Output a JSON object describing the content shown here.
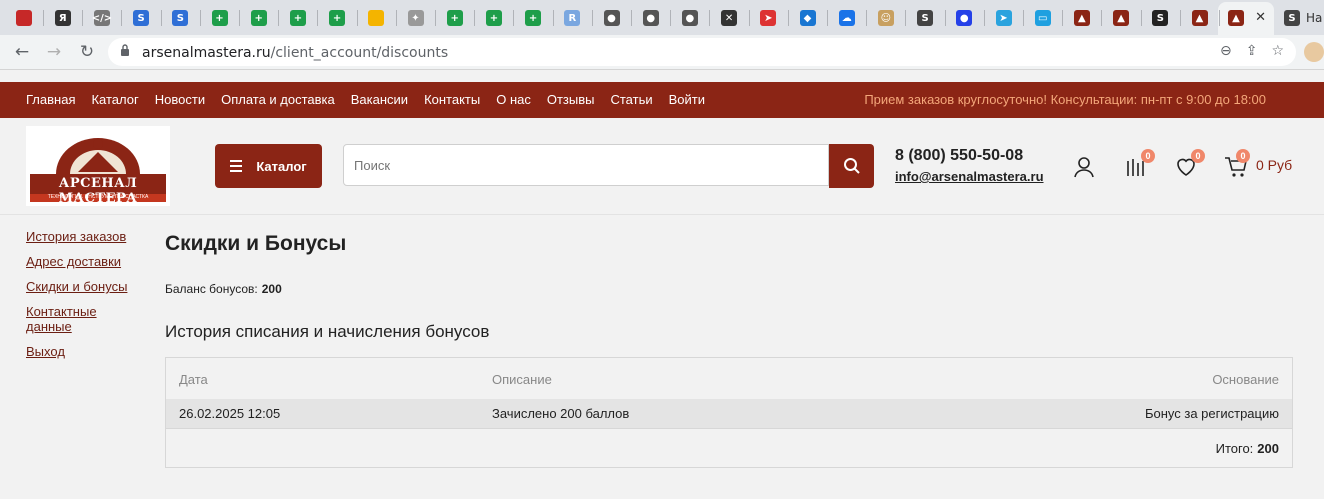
{
  "browser": {
    "active_tab_title": "На",
    "url_host": "arsenalmastera.ru",
    "url_path": "/client_account/discounts",
    "tab_favicons": [
      {
        "icon": "red-square-icon",
        "glyph": "",
        "bg": "#c62828"
      },
      {
        "icon": "yandex-icon",
        "glyph": "Я",
        "bg": "#333"
      },
      {
        "icon": "code-icon",
        "glyph": "</>",
        "bg": "#777"
      },
      {
        "icon": "blue-swirl-icon",
        "glyph": "S",
        "bg": "#2f6fd6"
      },
      {
        "icon": "blue-swirl-icon",
        "glyph": "S",
        "bg": "#2f6fd6"
      },
      {
        "icon": "green-sheet-icon",
        "glyph": "+",
        "bg": "#1e9e4a"
      },
      {
        "icon": "green-sheet-icon",
        "glyph": "+",
        "bg": "#1e9e4a"
      },
      {
        "icon": "green-sheet-icon",
        "glyph": "+",
        "bg": "#1e9e4a"
      },
      {
        "icon": "green-sheet-icon",
        "glyph": "+",
        "bg": "#1e9e4a"
      },
      {
        "icon": "multicolor-circle-icon",
        "glyph": "",
        "bg": "#f4b400"
      },
      {
        "icon": "eagle-icon",
        "glyph": "✦",
        "bg": "#999"
      },
      {
        "icon": "green-sheet-icon",
        "glyph": "+",
        "bg": "#1e9e4a"
      },
      {
        "icon": "green-sheet-icon",
        "glyph": "+",
        "bg": "#1e9e4a"
      },
      {
        "icon": "green-sheet-icon",
        "glyph": "+",
        "bg": "#1e9e4a"
      },
      {
        "icon": "r-letter-icon",
        "glyph": "R",
        "bg": "#7aa7e0"
      },
      {
        "icon": "globe-icon",
        "glyph": "●",
        "bg": "#555"
      },
      {
        "icon": "globe-icon",
        "glyph": "●",
        "bg": "#555"
      },
      {
        "icon": "globe-icon",
        "glyph": "●",
        "bg": "#555"
      },
      {
        "icon": "tools-icon",
        "glyph": "✕",
        "bg": "#333"
      },
      {
        "icon": "red-plane-icon",
        "glyph": "➤",
        "bg": "#d33"
      },
      {
        "icon": "blue-app-icon",
        "glyph": "◆",
        "bg": "#1976d2"
      },
      {
        "icon": "cloud-icon",
        "glyph": "☁",
        "bg": "#1a73e8"
      },
      {
        "icon": "face-icon",
        "glyph": "☺",
        "bg": "#c8a060"
      },
      {
        "icon": "s-letter-icon",
        "glyph": "S",
        "bg": "#444"
      },
      {
        "icon": "blue-dot-icon",
        "glyph": "●",
        "bg": "#2541e8"
      },
      {
        "icon": "telegram-icon",
        "glyph": "➤",
        "bg": "#2aa3de"
      },
      {
        "icon": "chat-icon",
        "glyph": "▭",
        "bg": "#1ea0e0"
      },
      {
        "icon": "arsenal-icon",
        "glyph": "▲",
        "bg": "#8b2515"
      },
      {
        "icon": "arsenal-icon",
        "glyph": "▲",
        "bg": "#8b2515"
      },
      {
        "icon": "s-dark-icon",
        "glyph": "S",
        "bg": "#222"
      },
      {
        "icon": "arsenal-icon",
        "glyph": "▲",
        "bg": "#8b2515"
      }
    ]
  },
  "topnav": {
    "links": [
      "Главная",
      "Каталог",
      "Новости",
      "Оплата и доставка",
      "Вакансии",
      "Контакты",
      "О нас",
      "Отзывы",
      "Статьи",
      "Войти"
    ],
    "notice": "Прием заказов круглосуточно! Консультации: пн-пт с 9:00 до 18:00"
  },
  "header": {
    "logo_text": "АРСЕНАЛ МАСТЕРА",
    "logo_subtext": "ТЕХНОЛОГИИ. ИНСТРУМЕНТ. ОСНАСТКА",
    "catalog_label": "Каталог",
    "search_placeholder": "Поиск",
    "phone": "8 (800) 550-50-08",
    "email": "info@arsenalmastera.ru",
    "compare_count": "0",
    "favorites_count": "0",
    "cart_count": "0",
    "cart_total": "0 Руб"
  },
  "sidebar": {
    "items": [
      "История заказов",
      "Адрес доставки",
      "Скидки и бонусы",
      "Контактные данные",
      "Выход"
    ]
  },
  "main": {
    "title": "Скидки и Бонусы",
    "balance_label": "Баланс бонусов:",
    "balance_value": "200",
    "history_title": "История списания и начисления бонусов",
    "table": {
      "headers": [
        "Дата",
        "Описание",
        "Основание"
      ],
      "rows": [
        [
          "26.02.2025 12:05",
          "Зачислено 200 баллов",
          "Бонус за регистрацию"
        ]
      ],
      "total_label": "Итого:",
      "total_value": "200"
    }
  },
  "colors": {
    "brand": "#8b2515",
    "notice": "#f4a77a",
    "badge": "#f0876a"
  }
}
